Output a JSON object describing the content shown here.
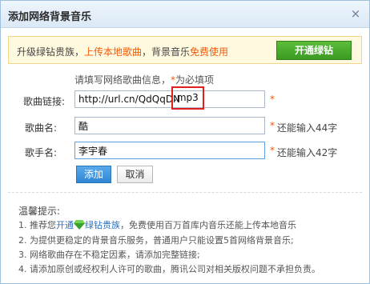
{
  "dialog": {
    "title": "添加网络背景音乐",
    "close_glyph": "×"
  },
  "promo": {
    "text_1": "升级绿钻贵族，",
    "text_highlight_1": "上传本地歌曲",
    "text_2": "，背景音乐",
    "text_highlight_2": "免费使用",
    "button": "开通绿钻"
  },
  "form": {
    "hint_prefix": "请填写网络歌曲信息，",
    "hint_star": "*",
    "hint_suffix": "为必填项",
    "required_mark": "*",
    "url": {
      "label": "歌曲链接:",
      "value": "http://url.cn/QdQqDN",
      "suffix": ".mp3"
    },
    "song": {
      "label": "歌曲名:",
      "value": "酷",
      "remain": "还能输入44字"
    },
    "singer": {
      "label": "歌手名:",
      "value": "李宇春",
      "remain": "还能输入42字"
    },
    "add_button": "添加",
    "cancel_button": "取消"
  },
  "tips": {
    "title": "温馨提示:",
    "item1_before": "1. 推荐您",
    "item1_link": "开通",
    "item1_link2": "绿钻贵族",
    "item1_after": "，免费使用百万首库内音乐还能上传本地音乐",
    "item2": "2. 为提供更稳定的背景音乐服务，普通用户只能设置5首网络背景音乐;",
    "item3": "3. 网络歌曲存在不稳定因素，请添加完整链接;",
    "item4": "4. 请添加原创或经权利人许可的歌曲，腾讯公司对相关版权问题不承担负责。"
  },
  "icons": {
    "close": "close-icon",
    "diamond": "green-diamond-icon"
  },
  "colors": {
    "accent_orange": "#f05a0a",
    "button_green": "#3a9a22",
    "button_blue": "#2f86d4",
    "highlight_red": "#e02020",
    "link_blue": "#2a6fc1"
  }
}
